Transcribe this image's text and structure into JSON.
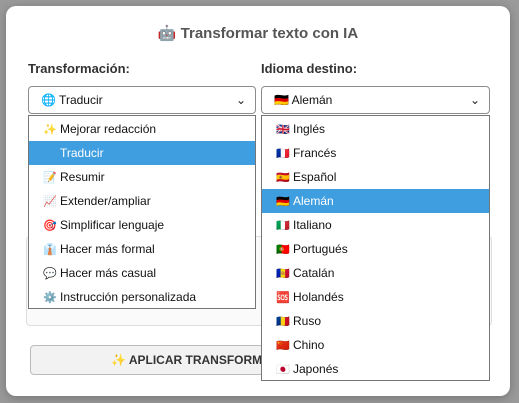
{
  "dialog": {
    "title": "🤖 Transformar texto con IA",
    "transform_label": "Transformación:",
    "language_label": "Idioma destino:",
    "apply_button": "✨ APLICAR TRANSFORM"
  },
  "transform_select": {
    "value": "🌐 Traducir",
    "options": [
      {
        "icon": "✨",
        "label": "Mejorar redacción",
        "selected": false
      },
      {
        "icon": "",
        "label": "Traducir",
        "selected": true
      },
      {
        "icon": "📝",
        "label": "Resumir",
        "selected": false
      },
      {
        "icon": "📈",
        "label": "Extender/ampliar",
        "selected": false
      },
      {
        "icon": "🎯",
        "label": "Simplificar lenguaje",
        "selected": false
      },
      {
        "icon": "👔",
        "label": "Hacer más formal",
        "selected": false
      },
      {
        "icon": "💬",
        "label": "Hacer más casual",
        "selected": false
      },
      {
        "icon": "⚙️",
        "label": "Instrucción personalizada",
        "selected": false
      }
    ]
  },
  "language_select": {
    "value": "🇩🇪 Alemán",
    "options": [
      {
        "icon": "🇬🇧",
        "label": "Inglés",
        "selected": false
      },
      {
        "icon": "🇫🇷",
        "label": "Francés",
        "selected": false
      },
      {
        "icon": "🇪🇸",
        "label": "Español",
        "selected": false
      },
      {
        "icon": "🇩🇪",
        "label": "Alemán",
        "selected": true
      },
      {
        "icon": "🇮🇹",
        "label": "Italiano",
        "selected": false
      },
      {
        "icon": "🇵🇹",
        "label": "Portugués",
        "selected": false
      },
      {
        "icon": "🇦🇩",
        "label": "Catalán",
        "selected": false
      },
      {
        "icon": "🆘",
        "label": "Holandés",
        "selected": false
      },
      {
        "icon": "🇷🇴",
        "label": "Ruso",
        "selected": false
      },
      {
        "icon": "🇨🇳",
        "label": "Chino",
        "selected": false
      },
      {
        "icon": "🇯🇵",
        "label": "Japonés",
        "selected": false
      }
    ]
  },
  "colors": {
    "selected_bg": "#3f9ee0",
    "overlay": "#9a9a9a"
  }
}
